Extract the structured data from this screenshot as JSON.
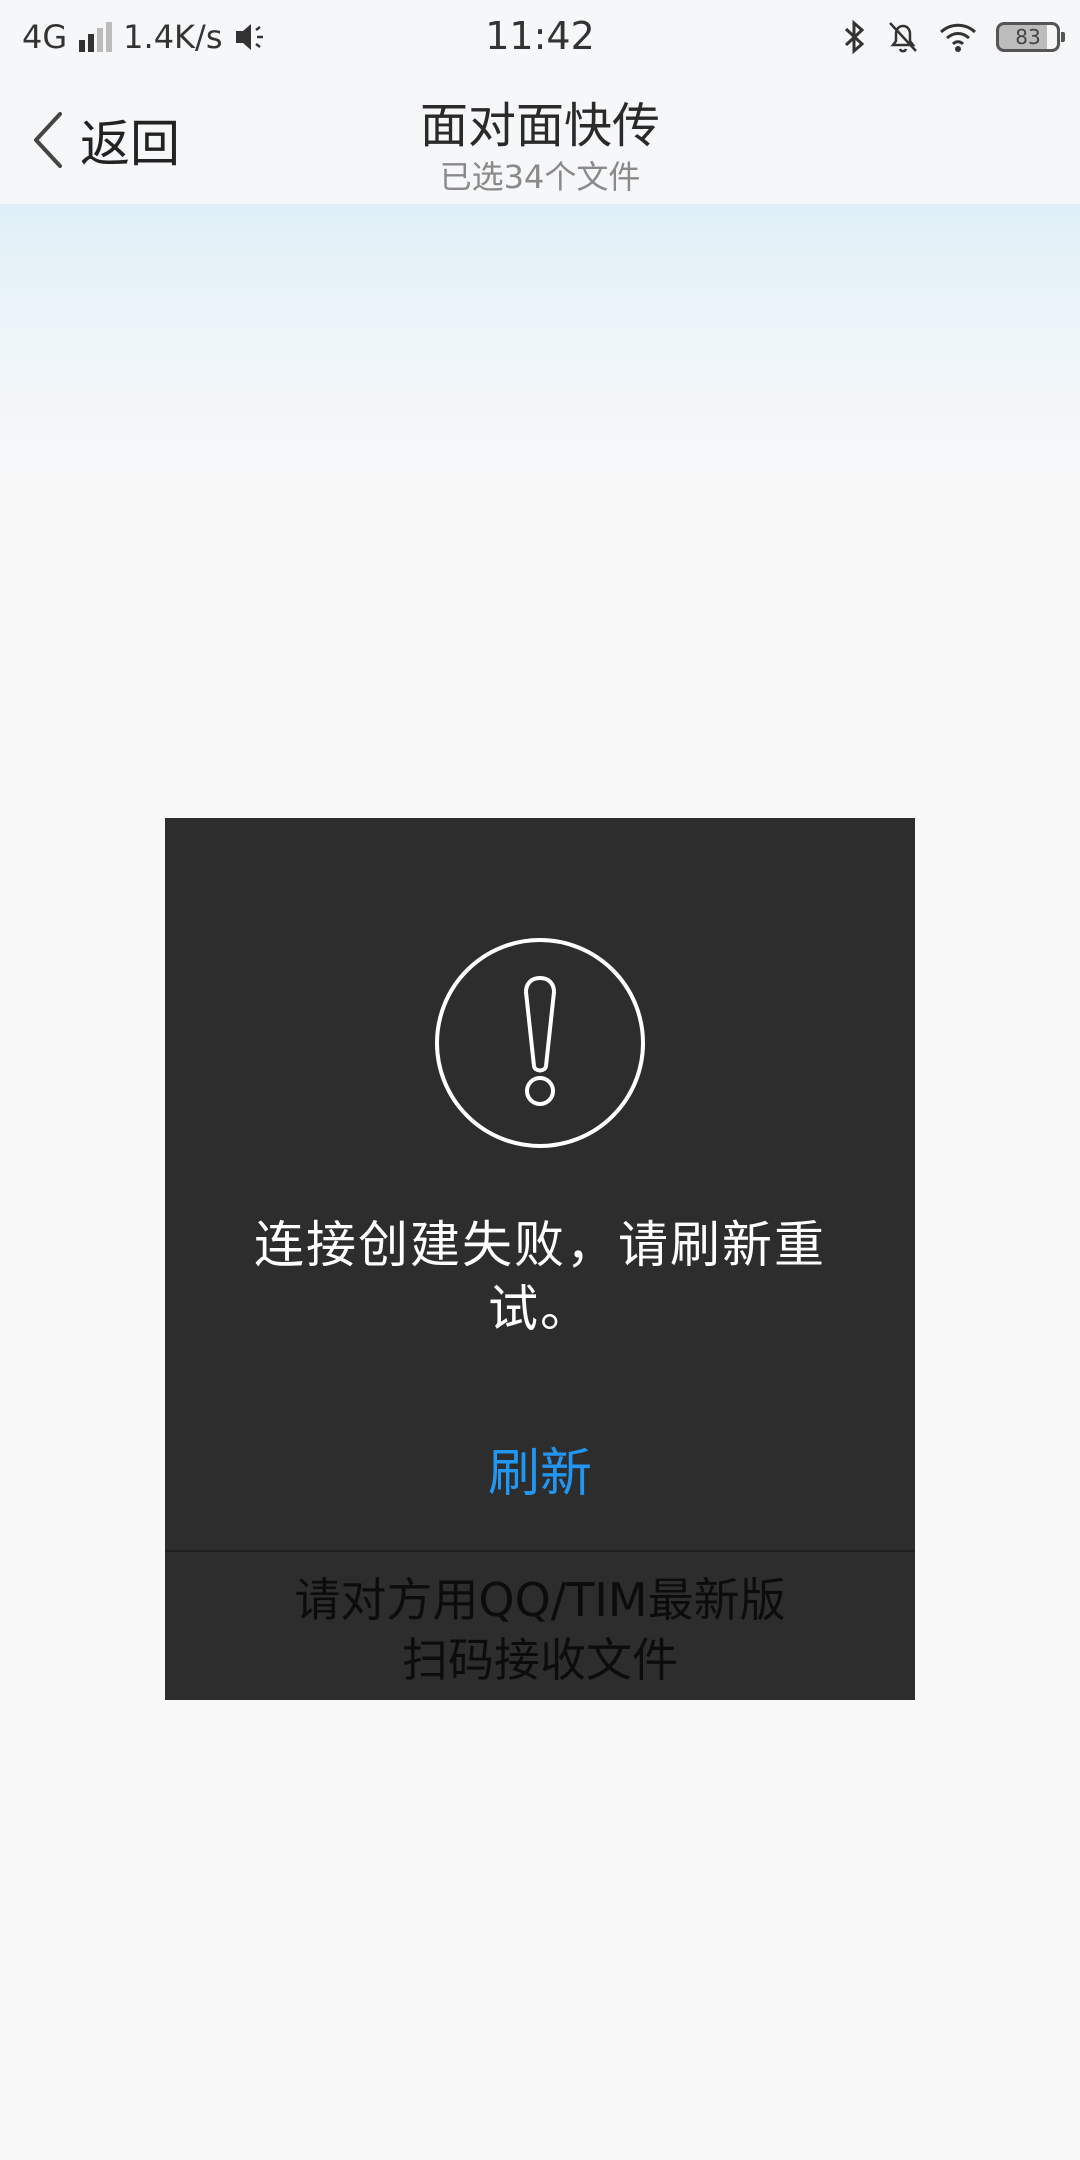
{
  "status_bar": {
    "network": "4G",
    "speed": "1.4K/s",
    "time": "11:42",
    "battery": "83",
    "icons": [
      "signal-icon",
      "mute-speaker-icon",
      "bluetooth-icon",
      "notifications-off-icon",
      "wifi-icon",
      "battery-icon"
    ]
  },
  "nav": {
    "back_label": "返回",
    "title": "面对面快传",
    "subtitle": "已选34个文件"
  },
  "dialog": {
    "icon": "warning-icon",
    "message_line1": "连接创建失败，请刷新重",
    "message_line2": "试。",
    "refresh_label": "刷新",
    "hint_line1": "请对方用QQ/TIM最新版",
    "hint_line2": "扫码接收文件"
  },
  "colors": {
    "accent": "#2196f3",
    "dialog_bg": "#2d2d2d",
    "header_bg": "#f5f7f9",
    "page_bg": "#f8f8f9"
  }
}
